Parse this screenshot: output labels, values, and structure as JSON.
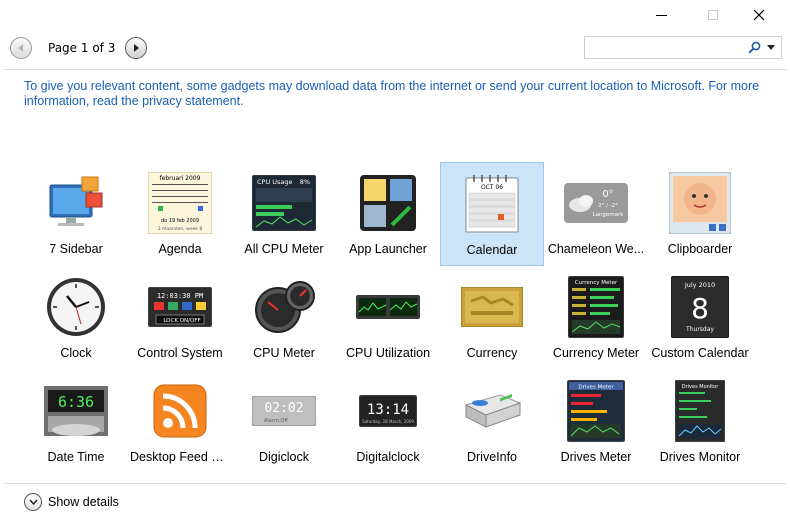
{
  "window": {
    "minimize_icon": "minimize-icon",
    "maximize_icon": "maximize-icon",
    "close_icon": "close-icon"
  },
  "pager": {
    "label": "Page 1 of 3",
    "prev_icon": "arrow-left-icon",
    "next_icon": "arrow-right-icon"
  },
  "search": {
    "value": "",
    "icon": "search-icon",
    "dropdown_icon": "chevron-down-icon"
  },
  "notice": "To give you relevant content, some gadgets may download data from the internet or send your current location to Microsoft. For more information, read the privacy statement.",
  "gadgets": [
    {
      "name": "7 Sidebar",
      "icon": "sidebar-icon",
      "selected": false
    },
    {
      "name": "Agenda",
      "icon": "agenda-icon",
      "selected": false
    },
    {
      "name": "All CPU Meter",
      "icon": "cpu-usage-icon",
      "selected": false
    },
    {
      "name": "App Launcher",
      "icon": "app-launcher-icon",
      "selected": false
    },
    {
      "name": "Calendar",
      "icon": "calendar-icon",
      "selected": true
    },
    {
      "name": "Chameleon We...",
      "icon": "weather-icon",
      "selected": false
    },
    {
      "name": "Clipboarder",
      "icon": "clipboarder-icon",
      "selected": false
    },
    {
      "name": "Clock",
      "icon": "clock-icon",
      "selected": false
    },
    {
      "name": "Control System",
      "icon": "control-system-icon",
      "selected": false
    },
    {
      "name": "CPU Meter",
      "icon": "cpu-meter-icon",
      "selected": false
    },
    {
      "name": "CPU Utilization",
      "icon": "cpu-utilization-icon",
      "selected": false
    },
    {
      "name": "Currency",
      "icon": "currency-icon",
      "selected": false
    },
    {
      "name": "Currency Meter",
      "icon": "currency-meter-icon",
      "selected": false
    },
    {
      "name": "Custom Calendar",
      "icon": "custom-calendar-icon",
      "selected": false
    },
    {
      "name": "Date Time",
      "icon": "date-time-icon",
      "selected": false
    },
    {
      "name": "Desktop Feed R...",
      "icon": "rss-feed-icon",
      "selected": false
    },
    {
      "name": "Digiclock",
      "icon": "digiclock-icon",
      "selected": false
    },
    {
      "name": "Digitalclock",
      "icon": "digitalclock-icon",
      "selected": false
    },
    {
      "name": "DriveInfo",
      "icon": "drive-icon",
      "selected": false
    },
    {
      "name": "Drives Meter",
      "icon": "drives-meter-icon",
      "selected": false
    },
    {
      "name": "Drives Monitor",
      "icon": "drives-monitor-icon",
      "selected": false
    }
  ],
  "thumb_text": {
    "agenda_month": "februari 2009",
    "agenda_date": "do 19 feb 2009",
    "agenda_week": "3 maanden, week 8",
    "cpu_usage_title": "CPU Usage",
    "cpu_usage_pct": "8%",
    "calendar_month": "OCT 06",
    "weather_temp": "0°",
    "weather_range": "2° / -2°",
    "weather_place": "Langemark",
    "currency_meter_title": "Currency Meter",
    "custom_cal_month": "July 2010",
    "custom_cal_day": "8",
    "custom_cal_weekday": "Thursday",
    "control_time": "12:03:30 PM",
    "control_lock": "LOCK ON/OFF",
    "date_time_clock": "6:36",
    "digiclock_time": "02:02",
    "digiclock_sub": "Alarm:Off",
    "digitalclock_time": "13:14",
    "digitalclock_date": "Saturday, 28 March, 2009",
    "drives_meter_title": "Drives Meter",
    "drives_monitor_title": "Drives Monitor"
  },
  "details": {
    "label": "Show details",
    "icon": "chevron-down-icon"
  }
}
